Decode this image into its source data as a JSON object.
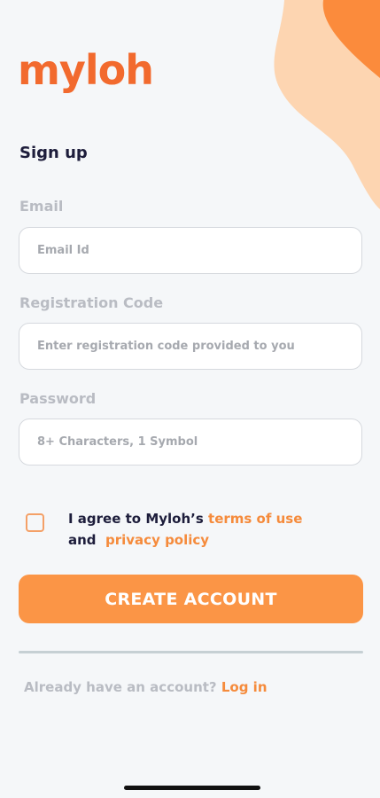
{
  "app": {
    "logo_text": "myloh"
  },
  "form": {
    "heading": "Sign up",
    "email": {
      "label": "Email",
      "placeholder": "Email Id",
      "value": ""
    },
    "registration": {
      "label": "Registration Code",
      "placeholder": "Enter registration code provided to you",
      "value": ""
    },
    "password": {
      "label": "Password",
      "placeholder": "8+ Characters, 1 Symbol",
      "value": ""
    },
    "agree": {
      "checked": false,
      "prefix": "I agree to Myloh’s",
      "terms_link": "terms of use",
      "and": "and",
      "privacy_link": "privacy policy"
    },
    "submit_label": "CREATE ACCOUNT"
  },
  "footer": {
    "prompt": "Already have an account?",
    "login_link": "Log in"
  },
  "colors": {
    "brand": "#f26a2e",
    "button": "#fb9546",
    "link": "#f58b3c",
    "deco_light": "#fdd5b1",
    "deco_dark": "#fb8b3c"
  }
}
